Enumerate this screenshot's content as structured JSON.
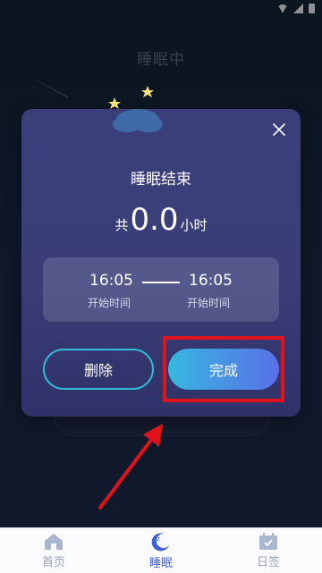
{
  "background": {
    "title": "睡眠中"
  },
  "dialog": {
    "title": "睡眠结束",
    "total_prefix": "共",
    "total_value": "0.0",
    "total_unit": "小时",
    "start_time": "16:05",
    "start_label": "开始时间",
    "end_time": "16:05",
    "end_label": "开始时间",
    "delete_label": "删除",
    "done_label": "完成",
    "close_icon": "close-icon"
  },
  "tabs": [
    {
      "label": "首页",
      "icon": "home-icon",
      "active": false
    },
    {
      "label": "睡眠",
      "icon": "sleep-moon-icon",
      "active": true
    },
    {
      "label": "日签",
      "icon": "calendar-icon",
      "active": false
    }
  ],
  "colors": {
    "accent": "#3f5fd8",
    "highlight": "#e0121b",
    "card": "#3a3f7a",
    "delete_border": "#33b8d8"
  }
}
